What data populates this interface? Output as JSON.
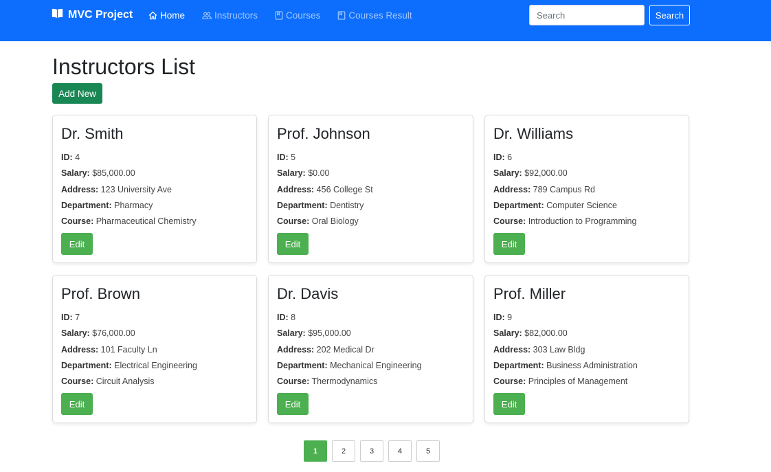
{
  "navbar": {
    "brand": "MVC Project",
    "links": [
      {
        "label": "Home",
        "icon": "house-icon",
        "active": true
      },
      {
        "label": "Instructors",
        "icon": "people-icon",
        "active": false
      },
      {
        "label": "Courses",
        "icon": "book-icon",
        "active": false
      },
      {
        "label": "Courses Result",
        "icon": "book-icon",
        "active": false
      }
    ],
    "search_placeholder": "Search",
    "search_value": "",
    "search_button": "Search"
  },
  "colors": {
    "navbar": "#0d6efd",
    "add_button": "#198754",
    "edit_button": "#4caf50",
    "active_page": "#4caf50"
  },
  "main": {
    "title": "Instructors List",
    "add_button": "Add New",
    "field_labels": {
      "id": "ID:",
      "salary": "Salary:",
      "address": "Address:",
      "department": "Department:",
      "course": "Course:"
    },
    "edit_label": "Edit",
    "instructors": [
      {
        "name": "Dr. Smith",
        "id": "4",
        "salary": "$85,000.00",
        "address": "123 University Ave",
        "department": "Pharmacy",
        "course": "Pharmaceutical Chemistry"
      },
      {
        "name": "Prof. Johnson",
        "id": "5",
        "salary": "$0.00",
        "address": "456 College St",
        "department": "Dentistry",
        "course": "Oral Biology"
      },
      {
        "name": "Dr. Williams",
        "id": "6",
        "salary": "$92,000.00",
        "address": "789 Campus Rd",
        "department": "Computer Science",
        "course": "Introduction to Programming"
      },
      {
        "name": "Prof. Brown",
        "id": "7",
        "salary": "$76,000.00",
        "address": "101 Faculty Ln",
        "department": "Electrical Engineering",
        "course": "Circuit Analysis"
      },
      {
        "name": "Dr. Davis",
        "id": "8",
        "salary": "$95,000.00",
        "address": "202 Medical Dr",
        "department": "Mechanical Engineering",
        "course": "Thermodynamics"
      },
      {
        "name": "Prof. Miller",
        "id": "9",
        "salary": "$82,000.00",
        "address": "303 Law Bldg",
        "department": "Business Administration",
        "course": "Principles of Management"
      }
    ]
  },
  "pagination": {
    "pages": [
      "1",
      "2",
      "3",
      "4",
      "5"
    ],
    "current": "1"
  }
}
